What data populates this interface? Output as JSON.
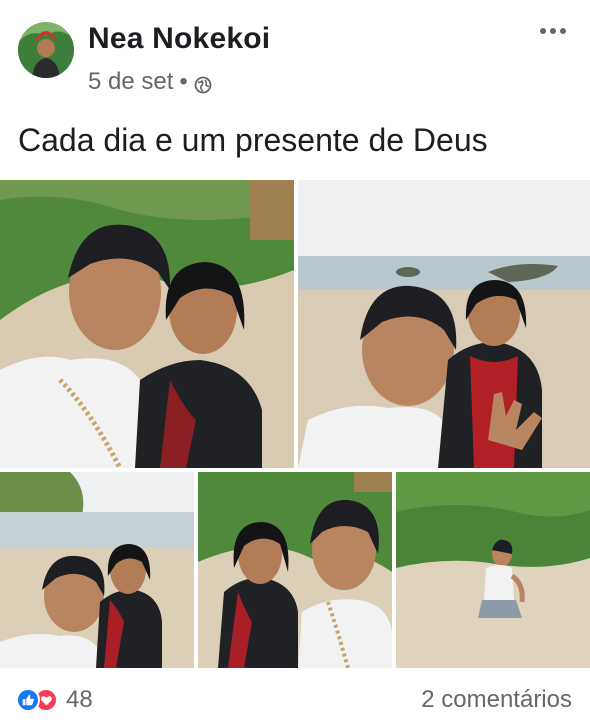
{
  "post": {
    "author": "Nea Nokekoi",
    "date": "5 de set",
    "separator": "•",
    "caption": "Cada dia e um presente de Deus",
    "reaction_count": "48",
    "comments_label": "2 comentários"
  },
  "icons": {
    "privacy": "globe-icon",
    "menu": "more-options-icon",
    "reactions": [
      "like-icon",
      "love-icon"
    ]
  },
  "colors": {
    "like": "#1877f2",
    "love": "#f33e58",
    "meta_text": "#65676b"
  }
}
